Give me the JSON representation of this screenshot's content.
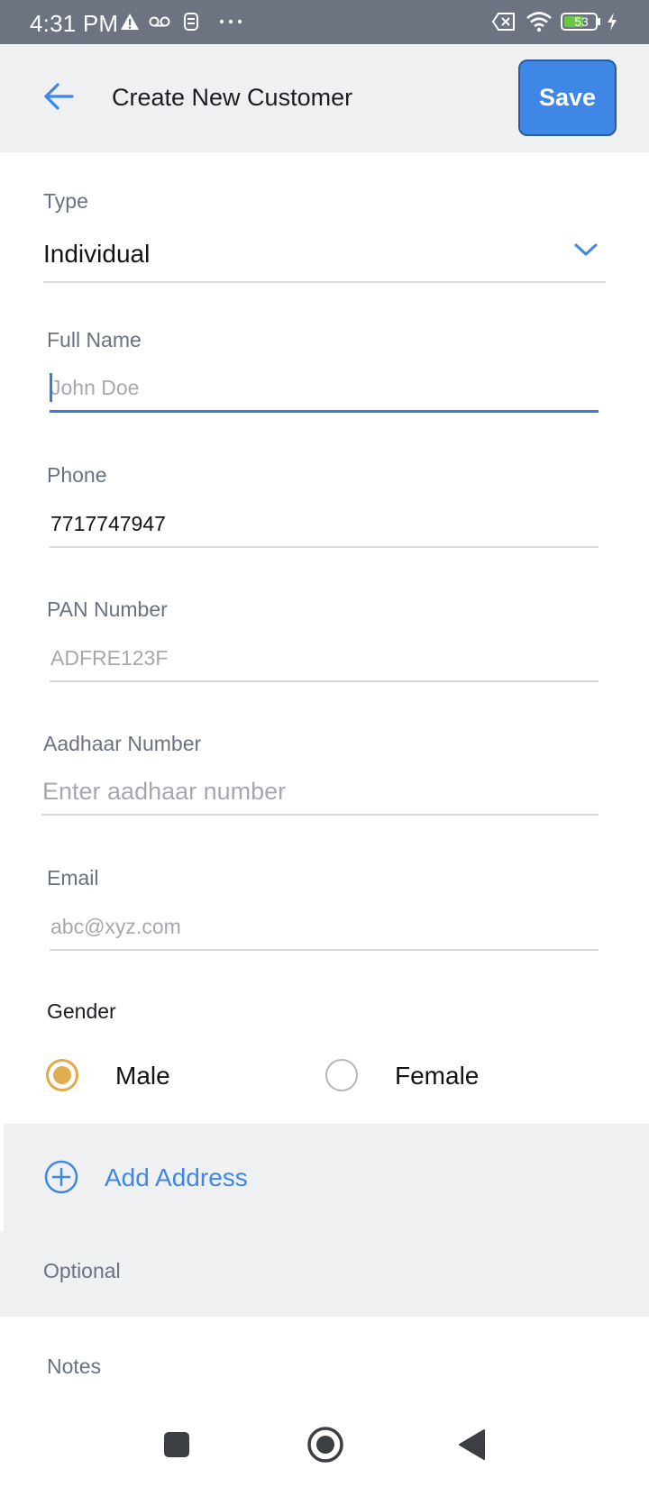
{
  "status_bar": {
    "time": "4:31 PM",
    "battery_level": "53",
    "icons": [
      "alert-icon",
      "voicemail-icon",
      "notification-icon",
      "more-icon",
      "sim-off-icon",
      "wifi-icon",
      "battery-icon",
      "charging-icon"
    ]
  },
  "app_bar": {
    "title": "Create New Customer",
    "save_label": "Save",
    "back_icon": "arrow-left-icon"
  },
  "form": {
    "type": {
      "label": "Type",
      "value": "Individual"
    },
    "full_name": {
      "label": "Full Name",
      "value": "",
      "placeholder": "John Doe"
    },
    "phone": {
      "label": "Phone",
      "value": "7717747947",
      "placeholder": ""
    },
    "pan": {
      "label": "PAN Number",
      "value": "",
      "placeholder": "ADFRE123F"
    },
    "aadhaar": {
      "label": "Aadhaar Number",
      "value": "",
      "placeholder": "Enter aadhaar number"
    },
    "email": {
      "label": "Email",
      "value": "",
      "placeholder": "abc@xyz.com"
    },
    "gender": {
      "label": "Gender",
      "options": [
        "Male",
        "Female"
      ],
      "selected": "Male"
    },
    "add_address_label": "Add Address",
    "optional_label": "Optional",
    "notes_label": "Notes"
  },
  "colors": {
    "accent": "#3f87e6",
    "radio_selected": "#e2ad4e",
    "status_bar": "#6b7480",
    "app_bar": "#eff0f2"
  },
  "nav_bar": {
    "icons": [
      "recents-square-icon",
      "home-circle-icon",
      "back-triangle-icon"
    ]
  }
}
